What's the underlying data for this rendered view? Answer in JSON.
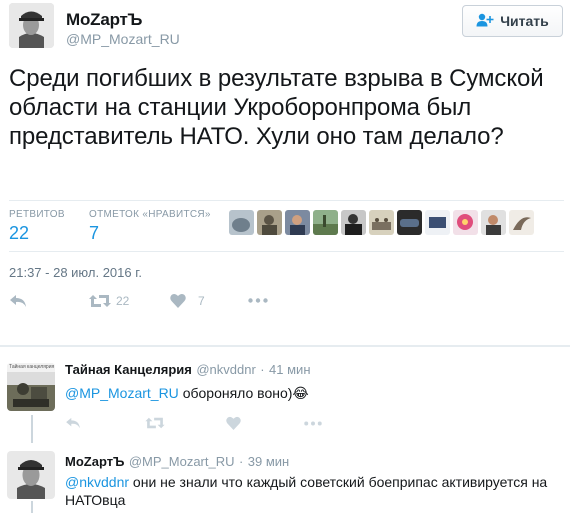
{
  "tweet": {
    "author_name": "MoZартЪ",
    "author_handle": "@MP_Mozart_RU",
    "follow_label": "Читать",
    "text": "Среди погибших в результате взрыва в Сумской области на станции Укроборонпрома был представитель НАТО. Хули оно там делало?",
    "stats": {
      "retweets_label": "РЕТВИТОВ",
      "retweets_value": "22",
      "likes_label": "ОТМЕТОК «НРАВИТСЯ»",
      "likes_value": "7"
    },
    "timestamp": "21:37 - 28 июл. 2016 г.",
    "actions": {
      "retweet_count": "22",
      "like_count": "7"
    }
  },
  "replies": [
    {
      "author_name": "Тайная Канцелярия",
      "author_handle": "@nkvddnr",
      "time": "41 мин",
      "mention": "@MP_Mozart_RU",
      "text": "обороняло воно)",
      "emoji": "😂",
      "avatar_caption": "Тайная канцелярия"
    },
    {
      "author_name": "MoZартЪ",
      "author_handle": "@MP_Mozart_RU",
      "time": "39 мин",
      "mention": "@nkvddnr",
      "text": "они не знали что каждый советский боеприпас активируется на НАТОвца"
    }
  ],
  "colors": {
    "link": "#1b95e0",
    "muted": "#8899a6",
    "action_icon": "#aab8c2",
    "divider": "#e6ecf0"
  }
}
